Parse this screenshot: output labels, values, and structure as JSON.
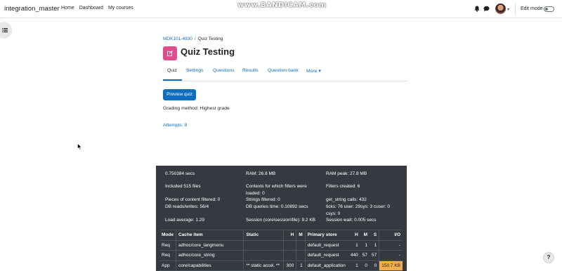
{
  "navbar": {
    "brand": "integration_master",
    "links": [
      "Home",
      "Dashboard",
      "My courses"
    ],
    "watermark": "www.BANDICAM.com",
    "edit_mode_label": "Edit mode"
  },
  "breadcrumb": {
    "course": "MDK101-4830",
    "separator": "/",
    "current": "Quiz Testing"
  },
  "page": {
    "title": "Quiz Testing",
    "icon_color": "#e04d8c"
  },
  "tabs": [
    {
      "label": "Quiz",
      "active": true
    },
    {
      "label": "Settings"
    },
    {
      "label": "Questions"
    },
    {
      "label": "Results"
    },
    {
      "label": "Question bank"
    },
    {
      "label": "More"
    }
  ],
  "main": {
    "preview_button": "Preview quiz",
    "grading_method": "Grading method: Highest grade",
    "attempts_link": "Attempts: 8"
  },
  "perf": {
    "time": "0.750384 secs",
    "ram": "RAM: 26.8 MB",
    "ram_peak": "RAM peak: 27.8 MB",
    "included": "Included 515 files",
    "contexts_1": "Contexts for which filters were",
    "contexts_2": "loaded: 0",
    "filters_created": "Filters created: 6",
    "pieces_filtered": "Pieces of content filtered: 0",
    "strings_filtered": "Strings filtered: 0",
    "get_string": "get_string calls: 432",
    "db_rw": "DB reads/writes: 56/4",
    "db_time": "DB queries time: 0.10892 secs",
    "ticks_1": "ticks: 76 user: 29sys: 3 cuser: 0",
    "ticks_2": "csys: 0",
    "load_avg": "Load average: 1.29",
    "session": "Session (core\\session\\file): 9.2 KB",
    "session_wait": "Session wait: 0.005 secs",
    "cache_table": {
      "headers": [
        "Mode",
        "Cache item",
        "Static",
        "H",
        "M",
        "Primary store",
        "H",
        "M",
        "S",
        "I/O"
      ],
      "rows": [
        [
          "Req",
          "adhoc/core_langmenu",
          "",
          "",
          "",
          "default_request",
          "1",
          "1",
          "1",
          "-"
        ],
        [
          "Req",
          "adhoc/core_string",
          "",
          "",
          "",
          "default_request",
          "440",
          "57",
          "57",
          "-"
        ],
        [
          "App",
          "core/capabilities",
          "** static accel. **",
          "300",
          "1",
          "default_application",
          "1",
          "0",
          "0",
          "150.7 KB"
        ]
      ]
    },
    "highlight_color": "#f0ad4e"
  }
}
